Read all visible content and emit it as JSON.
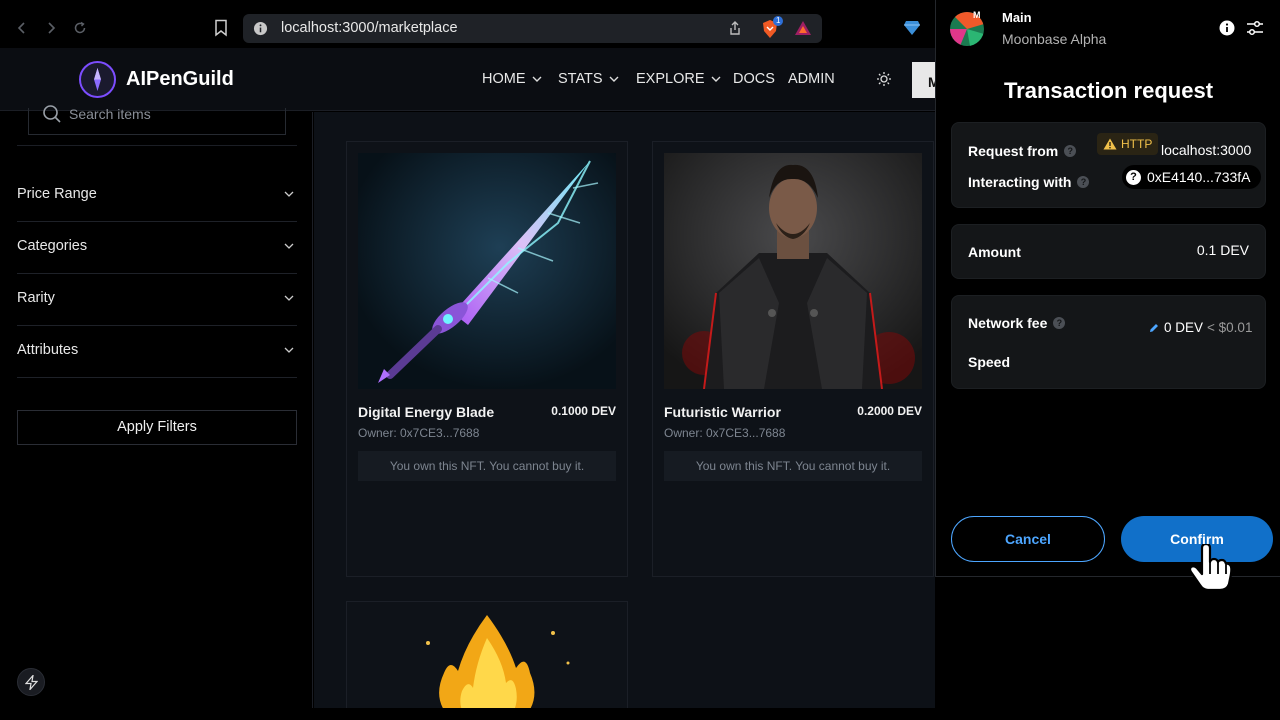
{
  "browser": {
    "url": "localhost:3000/marketplace",
    "brave_badge": "1"
  },
  "header": {
    "brand": "AIPenGuild",
    "nav": [
      {
        "label": "HOME"
      },
      {
        "label": "STATS"
      },
      {
        "label": "EXPLORE"
      },
      {
        "label": "DOCS"
      },
      {
        "label": "ADMIN"
      }
    ],
    "cta_initial": "M"
  },
  "sidebar": {
    "search_placeholder": "Search items",
    "filters": [
      {
        "label": "Price Range"
      },
      {
        "label": "Categories"
      },
      {
        "label": "Rarity"
      },
      {
        "label": "Attributes"
      }
    ],
    "apply_label": "Apply Filters"
  },
  "items": [
    {
      "name": "Digital Energy Blade",
      "price": "0.1000 DEV",
      "owner": "Owner: 0x7CE3...7688",
      "status": "You own this NFT. You cannot buy it."
    },
    {
      "name": "Futuristic Warrior",
      "price": "0.2000 DEV",
      "owner": "Owner: 0x7CE3...7688",
      "status": "You own this NFT. You cannot buy it."
    }
  ],
  "wallet": {
    "account_initial": "M",
    "account_name": "Main",
    "network": "Moonbase Alpha",
    "title": "Transaction request",
    "request_from_label": "Request from",
    "protocol_label": "HTTP",
    "origin": "localhost:3000",
    "interacting_label": "Interacting with",
    "contract": "0xE4140...733fA",
    "amount_label": "Amount",
    "amount": "0.1 DEV",
    "fee_label": "Network fee",
    "fee": "0 DEV",
    "fee_fiat": "< $0.01",
    "speed_label": "Speed",
    "cancel_label": "Cancel",
    "confirm_label": "Confirm"
  },
  "colors": {
    "accent_blue": "#1170c9",
    "link_blue": "#4da6ff",
    "brand_purple": "#7c4dff",
    "warning_yellow": "#f0c04a"
  }
}
